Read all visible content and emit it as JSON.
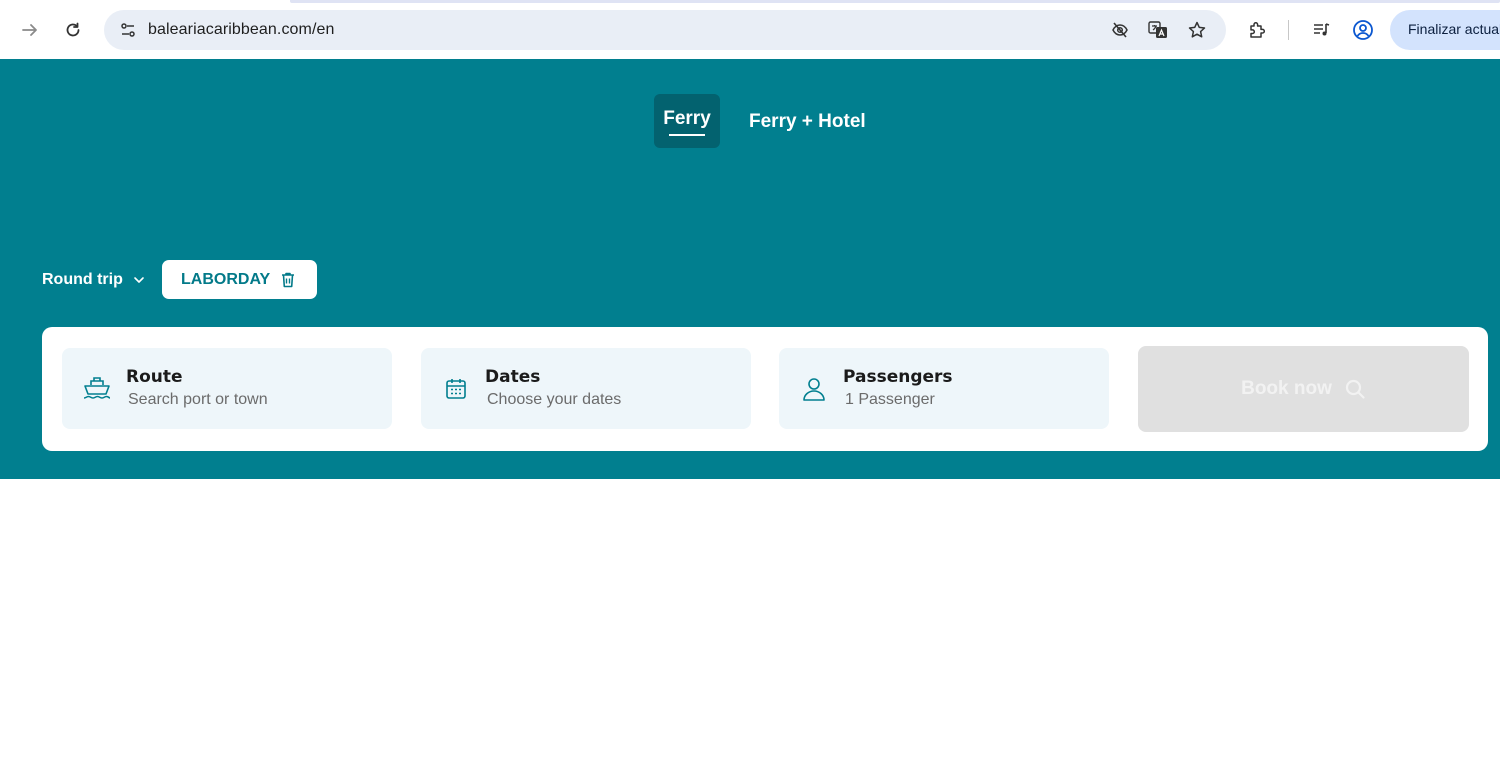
{
  "browser": {
    "url": "baleariacaribbean.com/en",
    "finalize_label": "Finalizar actual",
    "icons": [
      "forward-icon",
      "reload-icon",
      "site-info-icon",
      "eye-off-icon",
      "translate-icon",
      "bookmark-star-icon",
      "extensions-icon",
      "media-controls-icon",
      "profile-icon"
    ]
  },
  "tabs": {
    "ferry": "Ferry",
    "ferry_hotel": "Ferry + Hotel"
  },
  "trip": {
    "type_label": "Round trip",
    "promo_code": "LABORDAY"
  },
  "search": {
    "route": {
      "title": "Route",
      "placeholder": "Search port or town"
    },
    "dates": {
      "title": "Dates",
      "placeholder": "Choose your dates"
    },
    "passengers": {
      "title": "Passengers",
      "value": "1 Passenger"
    },
    "book_label": "Book now"
  },
  "colors": {
    "brand_teal": "#017f8f",
    "active_tab": "#03626f",
    "field_bg": "#eef6fa",
    "button_disabled": "#e0e0e0"
  }
}
